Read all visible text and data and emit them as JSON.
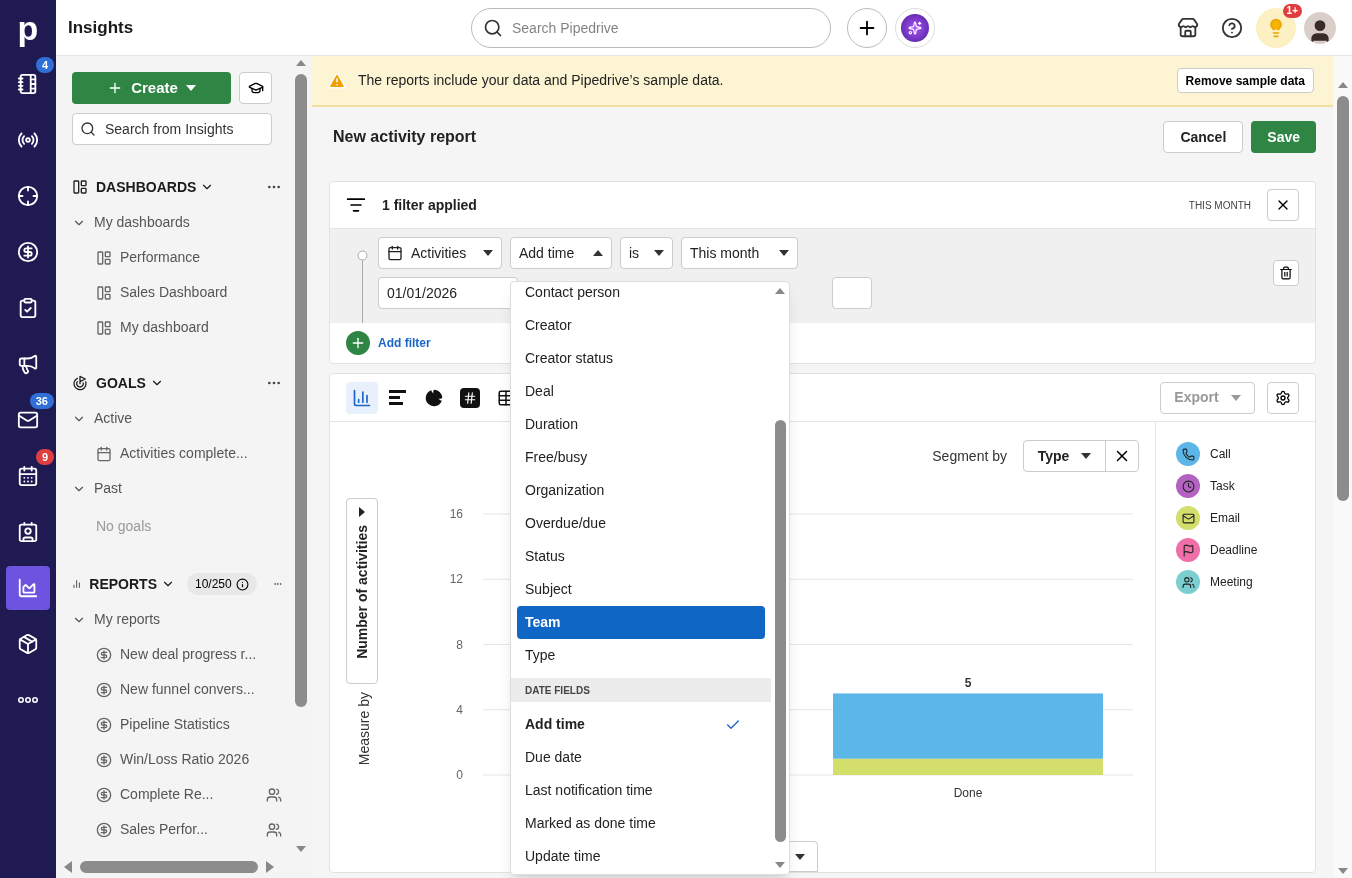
{
  "nav": {
    "logo": "p",
    "items": [
      {
        "selected": false,
        "badge": {
          "text": "4",
          "color": "#2f6fd6"
        }
      },
      {
        "selected": false
      },
      {
        "selected": false
      },
      {
        "selected": false
      },
      {
        "selected": false
      },
      {
        "selected": false
      },
      {
        "selected": false,
        "badge": {
          "text": "36",
          "color": "#2f6fd6"
        }
      },
      {
        "selected": false,
        "badge": {
          "text": "9",
          "color": "#e03e3e"
        }
      },
      {
        "selected": false
      },
      {
        "selected": true
      },
      {
        "selected": false
      },
      {
        "selected": false
      }
    ]
  },
  "topbar": {
    "title": "Insights",
    "search": {
      "placeholder": "Search Pipedrive"
    },
    "tips_badge": "1+"
  },
  "sidebar": {
    "create": "Create",
    "search": {
      "placeholder": "Search from Insights"
    },
    "sections": [
      {
        "title": "DASHBOARDS",
        "expanded": true,
        "groups": [
          {
            "title": "My dashboards",
            "expanded": true,
            "items": [
              {
                "label": "Performance",
                "shared": false
              },
              {
                "label": "Sales Dashboard",
                "shared": false
              },
              {
                "label": "My dashboard",
                "shared": false
              }
            ]
          }
        ]
      },
      {
        "title": "GOALS",
        "expanded": true,
        "groups": [
          {
            "title": "Active",
            "expanded": true,
            "items": [
              {
                "label": "Activities complete...",
                "shared": false
              }
            ]
          },
          {
            "title": "Past",
            "expanded": true,
            "empty": "No goals"
          }
        ]
      },
      {
        "title": "REPORTS",
        "expanded": true,
        "count": "10/250",
        "groups": [
          {
            "title": "My reports",
            "expanded": true,
            "items": [
              {
                "label": "New deal progress r...",
                "shared": false
              },
              {
                "label": "New funnel convers...",
                "shared": false
              },
              {
                "label": "Pipeline Statistics",
                "shared": false
              },
              {
                "label": "Win/Loss Ratio 2026",
                "shared": false
              },
              {
                "label": "Complete Re...",
                "shared": true
              },
              {
                "label": "Sales Perfor...",
                "shared": true
              }
            ]
          }
        ]
      }
    ]
  },
  "banner": {
    "text": "The reports include your data and Pipedrive’s sample data.",
    "button": "Remove sample data"
  },
  "header": {
    "title": "New activity report",
    "cancel": "Cancel",
    "save": "Save"
  },
  "filters": {
    "summary": "1 filter applied",
    "period": "THIS MONTH",
    "condition": {
      "entity": "Activities",
      "field": {
        "label": "Add time",
        "expanded": true
      },
      "operator": "is",
      "value": "This month",
      "date": "01/01/2026"
    },
    "add_filter": "Add filter"
  },
  "report": {
    "chart_types": [
      {
        "selected": true
      },
      {
        "selected": false
      },
      {
        "selected": false
      },
      {
        "selected": false
      },
      {
        "selected": false
      }
    ],
    "export": {
      "label": "Export",
      "disabled": true
    },
    "segment": {
      "label": "Segment by",
      "value": "Type"
    },
    "measure": {
      "label": "Measure by",
      "value": "Number of activities"
    },
    "chart_data": {
      "type": "bar",
      "stacked": true,
      "grid": true,
      "categories": [
        "Done"
      ],
      "ylim": [
        0,
        16
      ],
      "yticks": [
        0,
        4,
        8,
        12,
        16
      ],
      "annotations": [
        "5"
      ],
      "series": [
        {
          "name": "Call",
          "color": "#5db6e8",
          "values": [
            4
          ]
        },
        {
          "name": "Task",
          "color": "#b462c2",
          "values": [
            0
          ]
        },
        {
          "name": "Email",
          "color": "#d4de6a",
          "values": [
            1
          ]
        },
        {
          "name": "Deadline",
          "color": "#f06fa8",
          "values": [
            0
          ]
        },
        {
          "name": "Meeting",
          "color": "#7ccfd0",
          "values": [
            0
          ]
        }
      ]
    }
  },
  "dropdown": {
    "groups": [
      {
        "items": [
          {
            "label": "Contact person",
            "selected": false,
            "checked": false
          },
          {
            "label": "Creator",
            "selected": false,
            "checked": false
          },
          {
            "label": "Creator status",
            "selected": false,
            "checked": false
          },
          {
            "label": "Deal",
            "selected": false,
            "checked": false
          },
          {
            "label": "Duration",
            "selected": false,
            "checked": false
          },
          {
            "label": "Free/busy",
            "selected": false,
            "checked": false
          },
          {
            "label": "Organization",
            "selected": false,
            "checked": false
          },
          {
            "label": "Overdue/due",
            "selected": false,
            "checked": false
          },
          {
            "label": "Status",
            "selected": false,
            "checked": false
          },
          {
            "label": "Subject",
            "selected": false,
            "checked": false
          },
          {
            "label": "Team",
            "selected": true,
            "checked": false
          },
          {
            "label": "Type",
            "selected": false,
            "checked": false
          }
        ]
      },
      {
        "header": "DATE FIELDS",
        "items": [
          {
            "label": "Add time",
            "selected": false,
            "checked": true
          },
          {
            "label": "Due date",
            "selected": false,
            "checked": false
          },
          {
            "label": "Last notification time",
            "selected": false,
            "checked": false
          },
          {
            "label": "Marked as done time",
            "selected": false,
            "checked": false
          },
          {
            "label": "Update time",
            "selected": false,
            "checked": false
          }
        ]
      }
    ]
  }
}
